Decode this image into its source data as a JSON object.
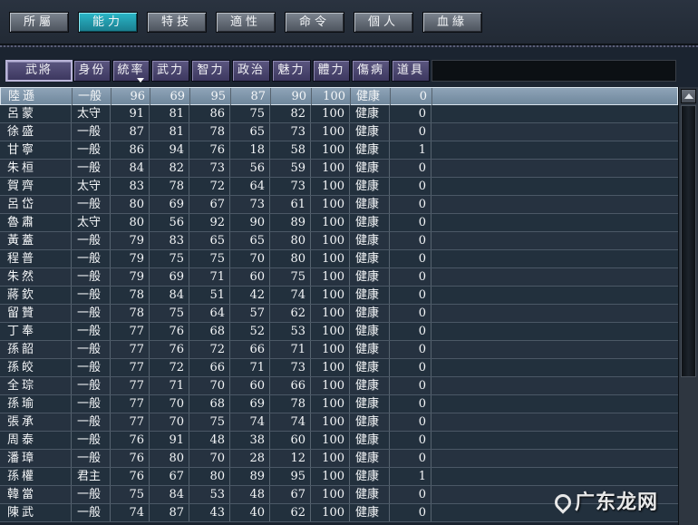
{
  "tabs": [
    {
      "label": "所屬",
      "active": false
    },
    {
      "label": "能力",
      "active": true
    },
    {
      "label": "特技",
      "active": false
    },
    {
      "label": "適性",
      "active": false
    },
    {
      "label": "命令",
      "active": false
    },
    {
      "label": "個人",
      "active": false
    },
    {
      "label": "血緣",
      "active": false
    }
  ],
  "columns": [
    "武將",
    "身份",
    "統率",
    "武力",
    "智力",
    "政治",
    "魅力",
    "體力",
    "傷病",
    "道具"
  ],
  "sorted_column": "統率",
  "rows": [
    {
      "name": "陸遜",
      "rank": "一般",
      "lead": "96",
      "war": "69",
      "int": "95",
      "pol": "87",
      "cha": "90",
      "hp": "100",
      "health": "健康",
      "item": "0"
    },
    {
      "name": "呂蒙",
      "rank": "太守",
      "lead": "91",
      "war": "81",
      "int": "86",
      "pol": "75",
      "cha": "82",
      "hp": "100",
      "health": "健康",
      "item": "0"
    },
    {
      "name": "徐盛",
      "rank": "一般",
      "lead": "87",
      "war": "81",
      "int": "78",
      "pol": "65",
      "cha": "73",
      "hp": "100",
      "health": "健康",
      "item": "0"
    },
    {
      "name": "甘寧",
      "rank": "一般",
      "lead": "86",
      "war": "94",
      "int": "76",
      "pol": "18",
      "cha": "58",
      "hp": "100",
      "health": "健康",
      "item": "1"
    },
    {
      "name": "朱桓",
      "rank": "一般",
      "lead": "84",
      "war": "82",
      "int": "73",
      "pol": "56",
      "cha": "59",
      "hp": "100",
      "health": "健康",
      "item": "0"
    },
    {
      "name": "賀齊",
      "rank": "太守",
      "lead": "83",
      "war": "78",
      "int": "72",
      "pol": "64",
      "cha": "73",
      "hp": "100",
      "health": "健康",
      "item": "0"
    },
    {
      "name": "呂岱",
      "rank": "一般",
      "lead": "80",
      "war": "69",
      "int": "67",
      "pol": "73",
      "cha": "61",
      "hp": "100",
      "health": "健康",
      "item": "0"
    },
    {
      "name": "魯肅",
      "rank": "太守",
      "lead": "80",
      "war": "56",
      "int": "92",
      "pol": "90",
      "cha": "89",
      "hp": "100",
      "health": "健康",
      "item": "0"
    },
    {
      "name": "黃蓋",
      "rank": "一般",
      "lead": "79",
      "war": "83",
      "int": "65",
      "pol": "65",
      "cha": "80",
      "hp": "100",
      "health": "健康",
      "item": "0"
    },
    {
      "name": "程普",
      "rank": "一般",
      "lead": "79",
      "war": "75",
      "int": "75",
      "pol": "70",
      "cha": "80",
      "hp": "100",
      "health": "健康",
      "item": "0"
    },
    {
      "name": "朱然",
      "rank": "一般",
      "lead": "79",
      "war": "69",
      "int": "71",
      "pol": "60",
      "cha": "75",
      "hp": "100",
      "health": "健康",
      "item": "0"
    },
    {
      "name": "蔣欽",
      "rank": "一般",
      "lead": "78",
      "war": "84",
      "int": "51",
      "pol": "42",
      "cha": "74",
      "hp": "100",
      "health": "健康",
      "item": "0"
    },
    {
      "name": "留贊",
      "rank": "一般",
      "lead": "78",
      "war": "75",
      "int": "64",
      "pol": "57",
      "cha": "62",
      "hp": "100",
      "health": "健康",
      "item": "0"
    },
    {
      "name": "丁奉",
      "rank": "一般",
      "lead": "77",
      "war": "76",
      "int": "68",
      "pol": "52",
      "cha": "53",
      "hp": "100",
      "health": "健康",
      "item": "0"
    },
    {
      "name": "孫韶",
      "rank": "一般",
      "lead": "77",
      "war": "76",
      "int": "72",
      "pol": "66",
      "cha": "71",
      "hp": "100",
      "health": "健康",
      "item": "0"
    },
    {
      "name": "孫皎",
      "rank": "一般",
      "lead": "77",
      "war": "72",
      "int": "66",
      "pol": "71",
      "cha": "73",
      "hp": "100",
      "health": "健康",
      "item": "0"
    },
    {
      "name": "全琮",
      "rank": "一般",
      "lead": "77",
      "war": "71",
      "int": "70",
      "pol": "60",
      "cha": "66",
      "hp": "100",
      "health": "健康",
      "item": "0"
    },
    {
      "name": "孫瑜",
      "rank": "一般",
      "lead": "77",
      "war": "70",
      "int": "68",
      "pol": "69",
      "cha": "78",
      "hp": "100",
      "health": "健康",
      "item": "0"
    },
    {
      "name": "張承",
      "rank": "一般",
      "lead": "77",
      "war": "70",
      "int": "75",
      "pol": "74",
      "cha": "74",
      "hp": "100",
      "health": "健康",
      "item": "0"
    },
    {
      "name": "周泰",
      "rank": "一般",
      "lead": "76",
      "war": "91",
      "int": "48",
      "pol": "38",
      "cha": "60",
      "hp": "100",
      "health": "健康",
      "item": "0"
    },
    {
      "name": "潘璋",
      "rank": "一般",
      "lead": "76",
      "war": "80",
      "int": "70",
      "pol": "28",
      "cha": "12",
      "hp": "100",
      "health": "健康",
      "item": "0"
    },
    {
      "name": "孫權",
      "rank": "君主",
      "lead": "76",
      "war": "67",
      "int": "80",
      "pol": "89",
      "cha": "95",
      "hp": "100",
      "health": "健康",
      "item": "1"
    },
    {
      "name": "韓當",
      "rank": "一般",
      "lead": "75",
      "war": "84",
      "int": "53",
      "pol": "48",
      "cha": "67",
      "hp": "100",
      "health": "健康",
      "item": "0"
    },
    {
      "name": "陳武",
      "rank": "一般",
      "lead": "74",
      "war": "87",
      "int": "43",
      "pol": "40",
      "cha": "62",
      "hp": "100",
      "health": "健康",
      "item": "0"
    }
  ],
  "selected_row": 0,
  "watermark": "广东龙网",
  "colors": {
    "active_tab": "#1f9aab",
    "header": "#4b4670",
    "selected_row": "#8298ac"
  }
}
